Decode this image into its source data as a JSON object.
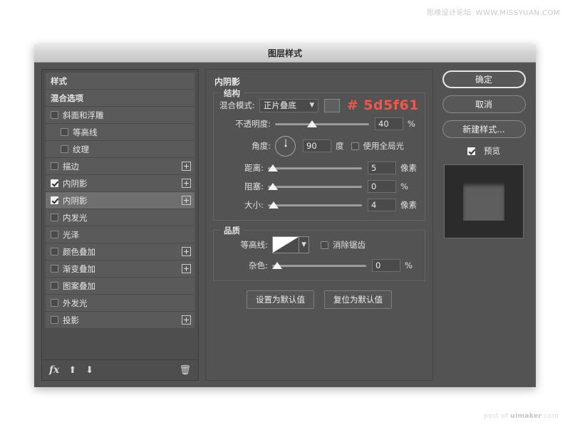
{
  "watermarks": {
    "top_cn": "思缘设计论坛",
    "top_url": "WWW.MISSYUAN.COM",
    "bottom_prefix": "post of ",
    "bottom_brand": "uimaker",
    "bottom_suffix": ".com"
  },
  "dialog": {
    "title": "图层样式"
  },
  "styles_panel": {
    "items": [
      {
        "label": "样式",
        "type": "header",
        "checkbox": null,
        "plus": false,
        "indent": false,
        "selected": false
      },
      {
        "label": "混合选项",
        "type": "header",
        "checkbox": null,
        "plus": false,
        "indent": false,
        "selected": false
      },
      {
        "label": "斜面和浮雕",
        "type": "effect",
        "checkbox": false,
        "plus": false,
        "indent": false,
        "selected": false
      },
      {
        "label": "等高线",
        "type": "sub",
        "checkbox": false,
        "plus": false,
        "indent": true,
        "selected": false
      },
      {
        "label": "纹理",
        "type": "sub",
        "checkbox": false,
        "plus": false,
        "indent": true,
        "selected": false
      },
      {
        "label": "描边",
        "type": "effect",
        "checkbox": false,
        "plus": true,
        "indent": false,
        "selected": false
      },
      {
        "label": "内阴影",
        "type": "effect",
        "checkbox": true,
        "plus": true,
        "indent": false,
        "selected": false
      },
      {
        "label": "内阴影",
        "type": "effect",
        "checkbox": true,
        "plus": true,
        "indent": false,
        "selected": true
      },
      {
        "label": "内发光",
        "type": "effect",
        "checkbox": false,
        "plus": false,
        "indent": false,
        "selected": false
      },
      {
        "label": "光泽",
        "type": "effect",
        "checkbox": false,
        "plus": false,
        "indent": false,
        "selected": false
      },
      {
        "label": "颜色叠加",
        "type": "effect",
        "checkbox": false,
        "plus": true,
        "indent": false,
        "selected": false
      },
      {
        "label": "渐变叠加",
        "type": "effect",
        "checkbox": false,
        "plus": true,
        "indent": false,
        "selected": false
      },
      {
        "label": "图案叠加",
        "type": "effect",
        "checkbox": false,
        "plus": false,
        "indent": false,
        "selected": false
      },
      {
        "label": "外发光",
        "type": "effect",
        "checkbox": false,
        "plus": false,
        "indent": false,
        "selected": false
      },
      {
        "label": "投影",
        "type": "effect",
        "checkbox": false,
        "plus": true,
        "indent": false,
        "selected": false
      }
    ],
    "toolbar": {
      "fx_label": "fx",
      "move_up_icon": "arrow-up-icon",
      "move_down_icon": "arrow-down-icon",
      "delete_icon": "trash-icon"
    }
  },
  "options": {
    "panel_title": "内阴影",
    "structure": {
      "legend": "结构",
      "blend_mode_label": "混合模式:",
      "blend_mode_value": "正片叠底",
      "color_swatch_hex": "#5d5f61",
      "color_note": "# 5d5f61",
      "opacity_label": "不透明度:",
      "opacity_value": "40",
      "opacity_unit": "%",
      "angle_label": "角度:",
      "angle_value": "90",
      "angle_unit": "度",
      "use_global_light_label": "使用全局光",
      "use_global_light_checked": false,
      "distance_label": "距离:",
      "distance_value": "5",
      "distance_unit": "像素",
      "choke_label": "阻塞:",
      "choke_value": "0",
      "choke_unit": "%",
      "size_label": "大小:",
      "size_value": "4",
      "size_unit": "像素"
    },
    "quality": {
      "legend": "品质",
      "contour_label": "等高线:",
      "antialias_label": "消除锯齿",
      "antialias_checked": false,
      "noise_label": "杂色:",
      "noise_value": "0",
      "noise_unit": "%"
    },
    "set_default_label": "设置为默认值",
    "reset_default_label": "复位为默认值"
  },
  "actions": {
    "ok_label": "确定",
    "cancel_label": "取消",
    "new_style_label": "新建样式...",
    "preview_label": "预览",
    "preview_checked": true
  }
}
